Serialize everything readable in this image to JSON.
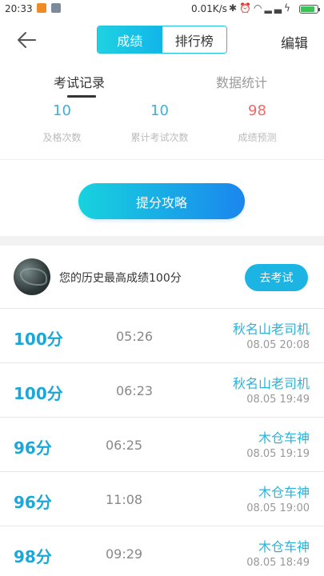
{
  "status_bar": {
    "time": "20:33",
    "network_speed": "0.01K/s",
    "battery_level": 0.85
  },
  "header": {
    "tabs": [
      {
        "label": "成绩",
        "active": true
      },
      {
        "label": "排行榜",
        "active": false
      }
    ],
    "edit_label": "编辑"
  },
  "subtabs": [
    {
      "label": "考试记录",
      "active": true
    },
    {
      "label": "数据统计",
      "active": false
    }
  ],
  "stats": [
    {
      "value": "10",
      "label": "及格次数",
      "color": "#3fb0d8"
    },
    {
      "value": "10",
      "label": "累计考试次数",
      "color": "#3fb0d8"
    },
    {
      "value": "98",
      "label": "成绩预测",
      "color": "#ef6b6b"
    }
  ],
  "strategy_button": "提分攻略",
  "best": {
    "text": "您的历史最高成绩100分",
    "button": "去考试"
  },
  "records": [
    {
      "score": "100分",
      "duration": "05:26",
      "name": "秋名山老司机",
      "date": "08.05  20:08"
    },
    {
      "score": "100分",
      "duration": "06:23",
      "name": "秋名山老司机",
      "date": "08.05  19:49"
    },
    {
      "score": "96分",
      "duration": "06:25",
      "name": "木仓车神",
      "date": "08.05  19:19"
    },
    {
      "score": "96分",
      "duration": "11:08",
      "name": "木仓车神",
      "date": "08.05  19:00"
    },
    {
      "score": "98分",
      "duration": "09:29",
      "name": "木仓车神",
      "date": "08.05  18:49"
    }
  ]
}
